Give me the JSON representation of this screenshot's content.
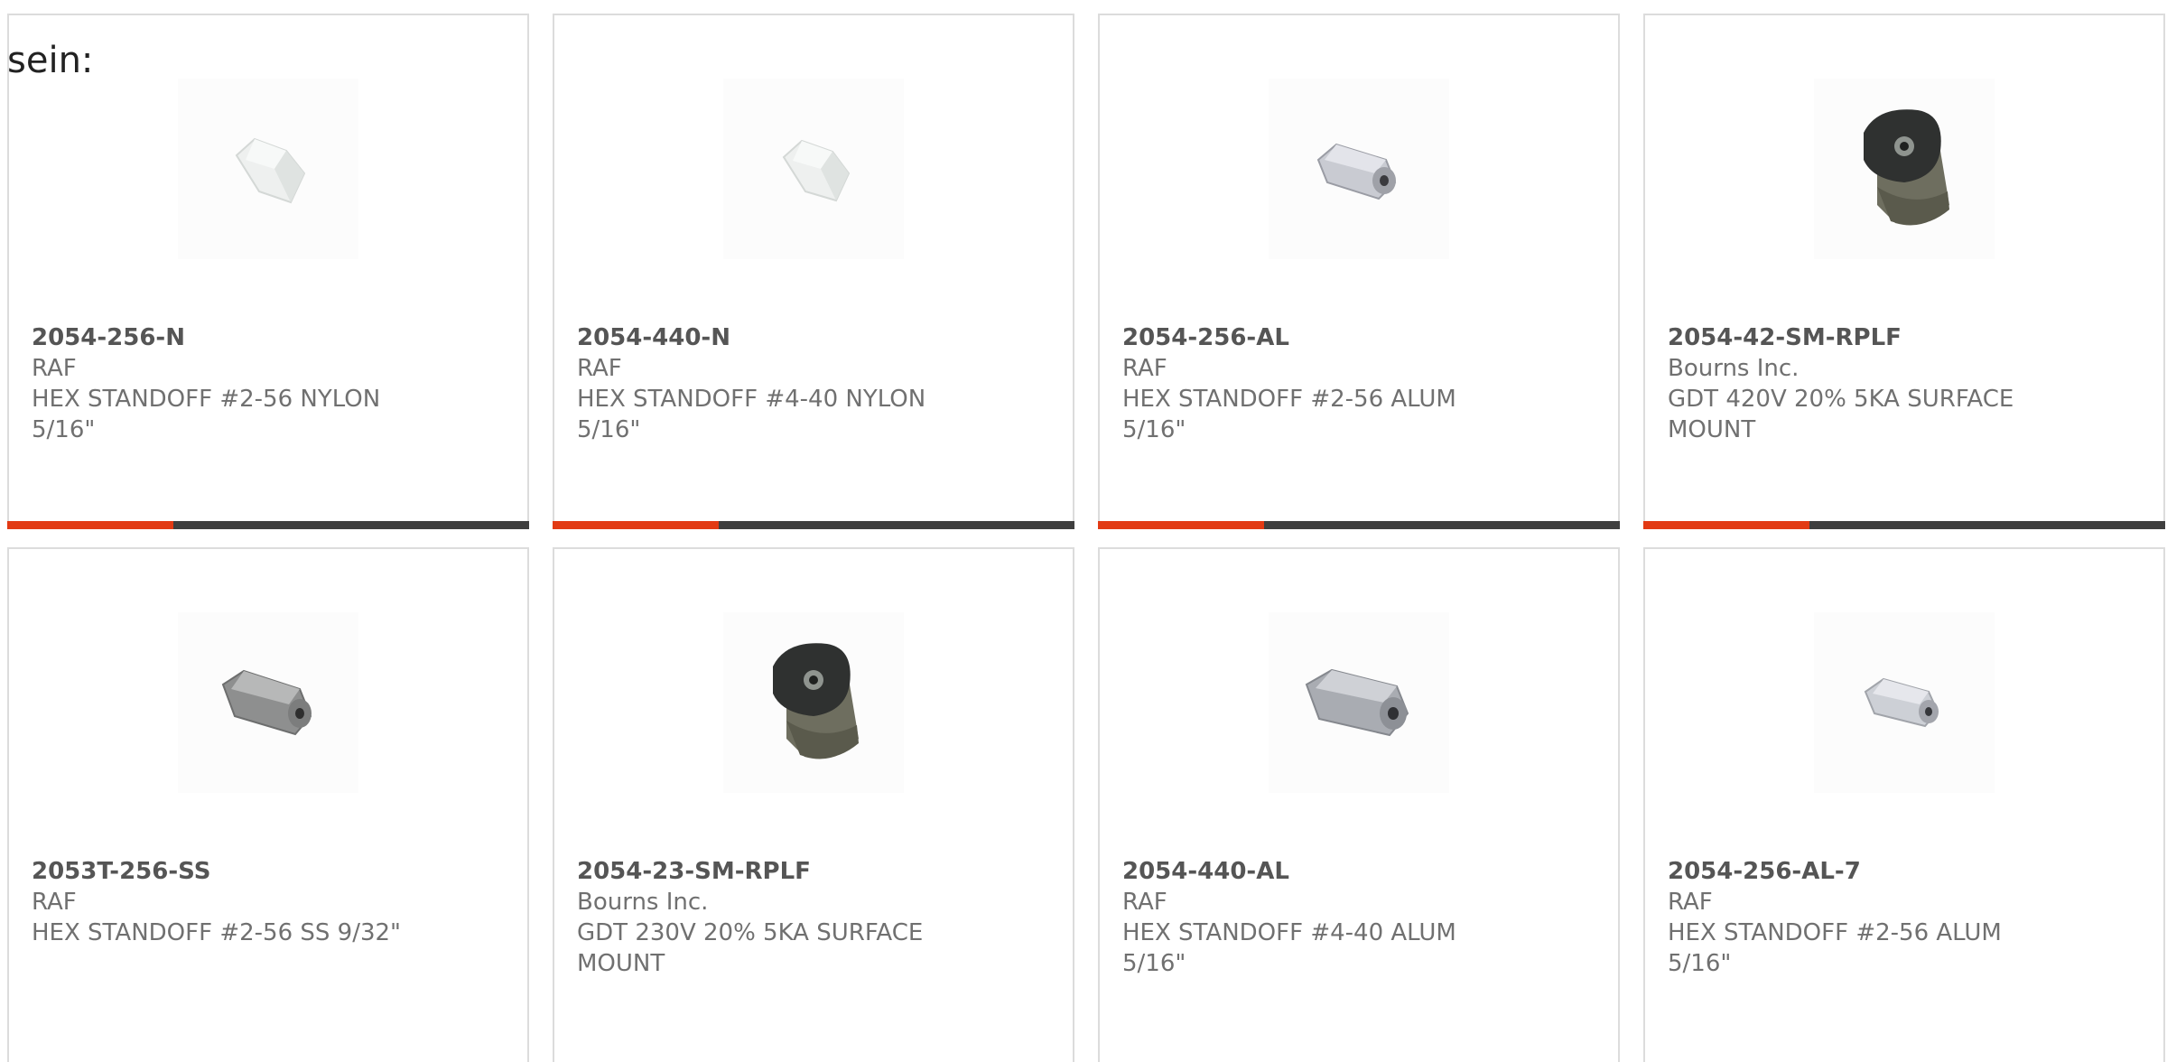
{
  "intro_text": "sein:",
  "products": [
    {
      "part_number": "2054-256-N",
      "manufacturer": "RAF",
      "description": "HEX STANDOFF #2-56 NYLON 5/16\"",
      "image_icon": "nylon-standoff-icon"
    },
    {
      "part_number": "2054-440-N",
      "manufacturer": "RAF",
      "description": "HEX STANDOFF #4-40 NYLON 5/16\"",
      "image_icon": "nylon-standoff-icon"
    },
    {
      "part_number": "2054-256-AL",
      "manufacturer": "RAF",
      "description": "HEX STANDOFF #2-56 ALUM 5/16\"",
      "image_icon": "aluminum-standoff-icon"
    },
    {
      "part_number": "2054-42-SM-RPLF",
      "manufacturer": "Bourns Inc.",
      "description": "GDT 420V 20% 5KA SURFACE MOUNT",
      "image_icon": "gas-discharge-tube-icon"
    },
    {
      "part_number": "2053T-256-SS",
      "manufacturer": "RAF",
      "description": "HEX STANDOFF #2-56 SS 9/32\"",
      "image_icon": "steel-standoff-icon"
    },
    {
      "part_number": "2054-23-SM-RPLF",
      "manufacturer": "Bourns Inc.",
      "description": "GDT 230V 20% 5KA SURFACE MOUNT",
      "image_icon": "gas-discharge-tube-icon"
    },
    {
      "part_number": "2054-440-AL",
      "manufacturer": "RAF",
      "description": "HEX STANDOFF #4-40 ALUM 5/16\"",
      "image_icon": "aluminum-standoff-icon"
    },
    {
      "part_number": "2054-256-AL-7",
      "manufacturer": "RAF",
      "description": "HEX STANDOFF #2-56 ALUM 5/16\"",
      "image_icon": "aluminum-standoff-icon"
    }
  ],
  "colors": {
    "accent": "#e23a14",
    "bar_track": "#3f3f3f",
    "border": "#dcdcdc",
    "text": "#707070"
  }
}
